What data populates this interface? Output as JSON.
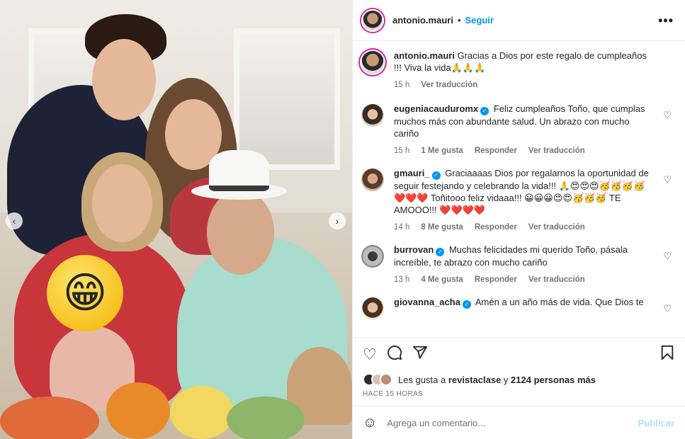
{
  "post": {
    "author": "antonio.mauri",
    "separator": "•",
    "follow_label": "Seguir",
    "more_label": "•••"
  },
  "caption": {
    "username": "antonio.mauri",
    "text": "Gracias a Dios por este regalo de cumpleaños !!! Viva la vida🙏🙏🙏",
    "time": "15 h",
    "translate": "Ver traducción"
  },
  "comments": [
    {
      "username": "eugeniacauduromx",
      "text": "Feliz cumpleaños Toño, que cumplas muchos más con abundante salud. Un abrazo con mucho cariño",
      "time": "15 h",
      "likes": "1 Me gusta",
      "reply": "Responder",
      "translate": "Ver traducción"
    },
    {
      "username": "gmauri_",
      "text": "Graciaaaas Dios por regalarnos la oportunidad de seguir festejando y celebrando la vida!!! 🙏😍😍😍🥳🥳🥳🥳❤️❤️❤️ Toñitooo feliz vidaaa!!! 😀😀😀😍😍🥳🥳🥳 TE AMOOO!!! ❤️❤️❤️❤️",
      "time": "14 h",
      "likes": "8 Me gusta",
      "reply": "Responder",
      "translate": "Ver traducción"
    },
    {
      "username": "burrovan",
      "text": "Muchas felicidades mi querido Toño, pásala increíble, te abrazo con mucho cariño",
      "time": "13 h",
      "likes": "4 Me gusta",
      "reply": "Responder",
      "translate": "Ver traducción"
    },
    {
      "username": "giovanna_acha",
      "text": "Amén a un año más de vida. Que Dios te",
      "time": "",
      "likes": "",
      "reply": "",
      "translate": ""
    }
  ],
  "likes": {
    "prefix": "Les gusta a",
    "user": "revistaclase",
    "connector": "y",
    "count": "2124 personas más"
  },
  "time_ago": "HACE 15 HORAS",
  "add_comment": {
    "placeholder": "Agrega un comentario...",
    "publish": "Publicar"
  },
  "icons": {
    "like": "heart-icon",
    "comment": "comment-icon",
    "share": "share-icon",
    "save": "bookmark-icon",
    "emoji": "emoji-icon",
    "prev": "chevron-left-icon",
    "next": "chevron-right-icon"
  },
  "colors": {
    "accent": "#0095f6",
    "publish_disabled": "#b2dffc",
    "meta_text": "#737373"
  }
}
